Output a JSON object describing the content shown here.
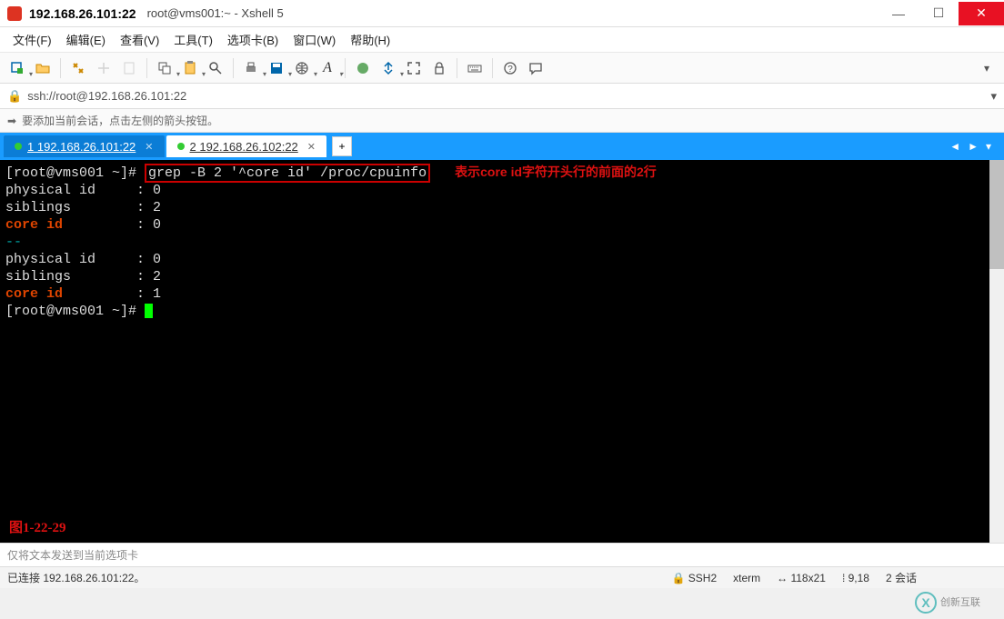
{
  "window": {
    "title_bold": "192.168.26.101:22",
    "title_rest": "root@vms001:~ - Xshell 5"
  },
  "menu": {
    "file": "文件(F)",
    "edit": "编辑(E)",
    "view": "查看(V)",
    "tools": "工具(T)",
    "tabs": "选项卡(B)",
    "window": "窗口(W)",
    "help": "帮助(H)"
  },
  "address": {
    "url": "ssh://root@192.168.26.101:22"
  },
  "hint": {
    "text": "要添加当前会话，点击左侧的箭头按钮。"
  },
  "tabs": [
    {
      "label": "1 192.168.26.101:22",
      "active": true
    },
    {
      "label": "2 192.168.26.102:22",
      "active": false
    }
  ],
  "terminal": {
    "prompt1": "[root@vms001 ~]# ",
    "cmd": "grep -B 2 '^core id' /proc/cpuinfo",
    "annotation": "表示core id字符开头行的前面的2行",
    "lines": [
      "physical id     : 0",
      "siblings        : 2"
    ],
    "coreid0": "core id",
    "coreid0_val": "         : 0",
    "separator": "--",
    "lines2": [
      "physical id     : 0",
      "siblings        : 2"
    ],
    "coreid1": "core id",
    "coreid1_val": "         : 1",
    "prompt2": "[root@vms001 ~]# ",
    "figure_label": "图1-22-29"
  },
  "input": {
    "placeholder": "仅将文本发送到当前选项卡"
  },
  "status": {
    "left": "已连接 192.168.26.101:22。",
    "ssh": "SSH2",
    "term": "xterm",
    "size": "118x21",
    "pos": "9,18",
    "sessions": "2 会话"
  },
  "watermark": {
    "brand": "创新互联"
  }
}
